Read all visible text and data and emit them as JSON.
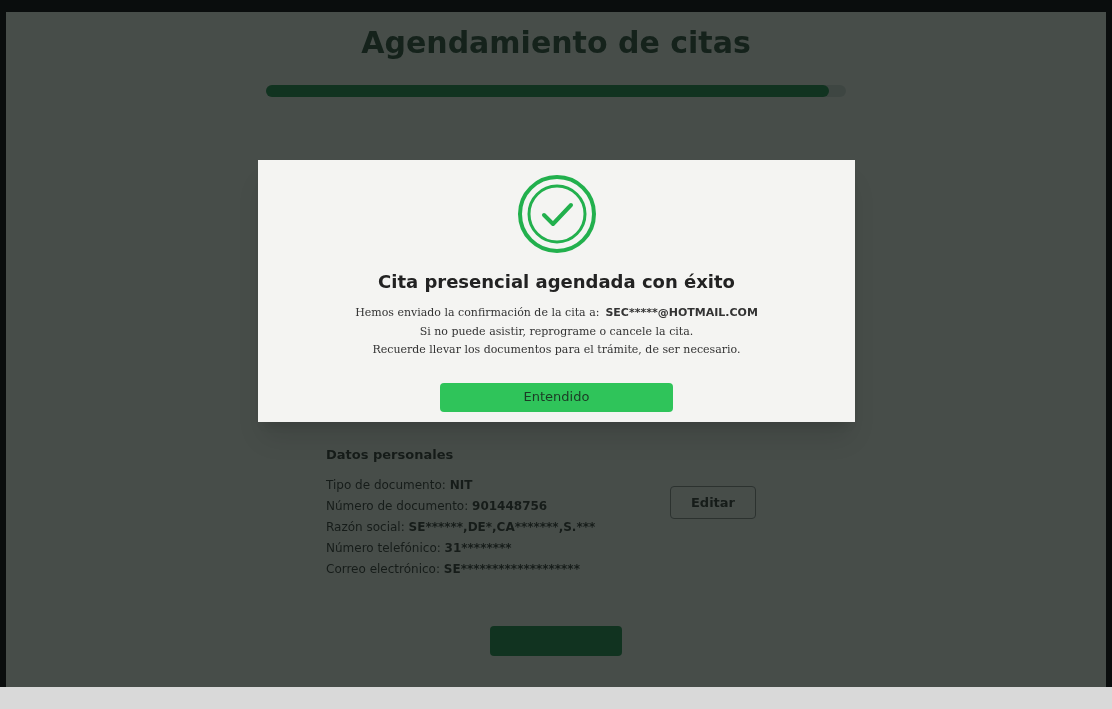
{
  "page": {
    "title": "Agendamiento de citas",
    "progress": {
      "level": 0.97
    }
  },
  "personal_data": {
    "heading": "Datos personales",
    "fields": [
      {
        "label": "Tipo de documento:",
        "value": "NIT"
      },
      {
        "label": "Número de documento:",
        "value": "901448756"
      },
      {
        "label": "Razón social:",
        "value": "SE******,DE*,CA*******,S.***"
      },
      {
        "label": "Número telefónico:",
        "value": "31********"
      },
      {
        "label": "Correo electrónico:",
        "value": "SE*******************"
      }
    ],
    "edit_button": "Editar"
  },
  "dialog": {
    "title": "Cita presencial agendada con éxito",
    "lines": [
      "Hemos enviado la confirmación de la cita a:",
      "Si no puede asistir, reprograme o cancele la cita.",
      "Recuerde llevar los documentos para el trámite, de ser necesario."
    ],
    "email": "SEC*****@HOTMAIL.COM",
    "button": "Entendido"
  }
}
